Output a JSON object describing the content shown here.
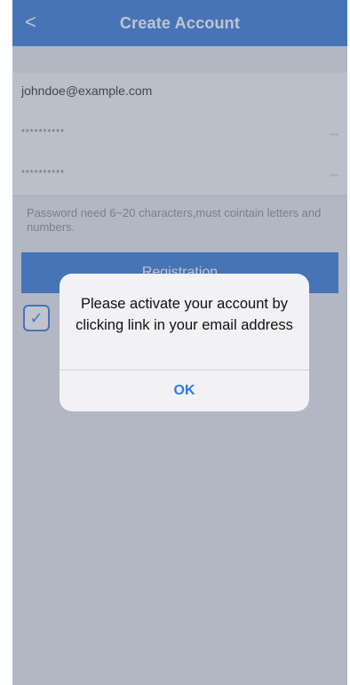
{
  "header": {
    "back_icon": "chevron-left-icon",
    "back_glyph": "<",
    "title": "Create Account"
  },
  "form": {
    "email_value": "johndoe@example.com",
    "password_mask": "**********",
    "confirm_mask": "**********",
    "helper_text": "Password need 6~20 characters,must cointain letters and numbers.",
    "register_label": "Registration",
    "checkbox_checked": true
  },
  "dialog": {
    "message": "Please activate your account by clicking link in your email address",
    "ok_label": "OK"
  },
  "colors": {
    "accent": "#3c7fd9",
    "overlay": "rgba(90,100,125,0.38)"
  }
}
